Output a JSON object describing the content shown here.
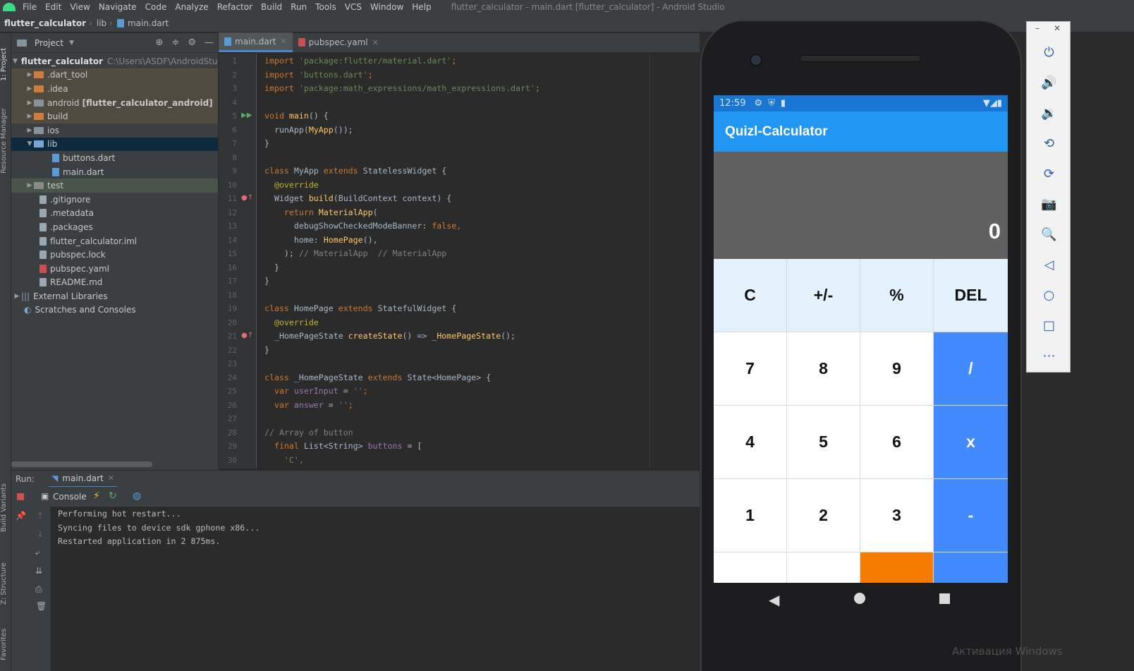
{
  "window_title": "flutter_calculator - main.dart [flutter_calculator] - Android Studio",
  "menu": [
    "File",
    "Edit",
    "View",
    "Navigate",
    "Code",
    "Analyze",
    "Refactor",
    "Build",
    "Run",
    "Tools",
    "VCS",
    "Window",
    "Help"
  ],
  "breadcrumb": {
    "project": "flutter_calculator",
    "folder": "lib",
    "file": "main.dart"
  },
  "left_strip": {
    "project": "1: Project",
    "resource": "Resource Manager",
    "build_variants": "Build Variants",
    "structure": "Z: Structure",
    "favorites": "Favorites"
  },
  "project_pane": {
    "title": "Project",
    "root": {
      "name": "flutter_calculator",
      "path": "C:\\Users\\ASDF\\AndroidStudio"
    },
    "items": [
      {
        "label": ".dart_tool"
      },
      {
        "label": ".idea"
      },
      {
        "label": "android",
        "extra": "[flutter_calculator_android]"
      },
      {
        "label": "build"
      },
      {
        "label": "ios"
      },
      {
        "label": "lib"
      },
      {
        "label": "buttons.dart"
      },
      {
        "label": "main.dart"
      },
      {
        "label": "test"
      },
      {
        "label": ".gitignore"
      },
      {
        "label": ".metadata"
      },
      {
        "label": ".packages"
      },
      {
        "label": "flutter_calculator.iml"
      },
      {
        "label": "pubspec.lock"
      },
      {
        "label": "pubspec.yaml"
      },
      {
        "label": "README.md"
      },
      {
        "label": "External Libraries"
      },
      {
        "label": "Scratches and Consoles"
      }
    ]
  },
  "editor_tabs": [
    {
      "label": "main.dart"
    },
    {
      "label": "pubspec.yaml"
    }
  ],
  "line_numbers": [
    "1",
    "2",
    "3",
    "4",
    "5",
    "6",
    "7",
    "8",
    "9",
    "10",
    "11",
    "12",
    "13",
    "14",
    "15",
    "16",
    "17",
    "18",
    "19",
    "20",
    "21",
    "22",
    "23",
    "24",
    "25",
    "26",
    "27",
    "28",
    "29",
    "30"
  ],
  "code": {
    "l1a": "import ",
    "l1b": "'package:flutter/material.dart'",
    "l1c": ";",
    "l2a": "import ",
    "l2b": "'buttons.dart'",
    "l2c": ";",
    "l3a": "import ",
    "l3b": "'package:math_expressions/math_expressions.dart'",
    "l3c": ";",
    "l5a": "void ",
    "l5b": "main",
    "l5c": "() {",
    "l6a": "  runApp(",
    "l6b": "MyApp",
    "l6c": "());",
    "l7": "}",
    "l9a": "class ",
    "l9b": "MyApp ",
    "l9c": "extends ",
    "l9d": "StatelessWidget {",
    "l10": "  @override",
    "l11a": "  Widget ",
    "l11b": "build",
    "l11c": "(BuildContext context) {",
    "l12a": "    return ",
    "l12b": "MaterialApp",
    "l12c": "(",
    "l13a": "      debugShowCheckedModeBanner: ",
    "l13b": "false",
    ",": ",",
    "l14a": "      home: ",
    "l14b": "HomePage",
    "l14c": "(),",
    "l15a": "    ); ",
    "l15b": "// MaterialApp  // MaterialApp",
    "l16": "  }",
    "l17": "}",
    "l19a": "class ",
    "l19b": "HomePage ",
    "l19c": "extends ",
    "l19d": "StatefulWidget {",
    "l20": "  @override",
    "l21a": "  _HomePageState ",
    "l21b": "createState",
    "l21c": "() => ",
    "l21d": "_HomePageState",
    "l21e": "();",
    "l22": "}",
    "l24a": "class ",
    "l24b": "_HomePageState ",
    "l24c": "extends ",
    "l24d": "State<HomePage> {",
    "l25a": "  var ",
    "l25b": "userInput",
    " l25c": " = ",
    "l25d": "''",
    ";": ";",
    "l26a": "  var ",
    "l26b": "answer",
    "l26d": "''",
    "l28": "// Array of button",
    "l29a": "  final ",
    "l29b": "List<String> ",
    "l29c": "buttons",
    " l29d": " = [",
    "l30": "    'C',"
  },
  "run": {
    "label": "Run:",
    "tab": "main.dart",
    "console_tab": "Console",
    "lines": [
      "Performing hot restart...",
      "Syncing files to device sdk gphone x86...",
      "Restarted application in 2 875ms."
    ]
  },
  "device": {
    "time": "12:59",
    "app_title": "Quizl-Calculator",
    "answer": "0",
    "buttons": [
      "C",
      "+/-",
      "%",
      "DEL",
      "7",
      "8",
      "9",
      "/",
      "4",
      "5",
      "6",
      "x",
      "1",
      "2",
      "3",
      "-"
    ]
  },
  "watermark": "Активация Windows",
  "colors": {
    "appbar": "#2196f3",
    "operator": "#448aff",
    "equals": "#f57c00",
    "display": "#616161",
    "top_row": "#e3f2fd"
  }
}
